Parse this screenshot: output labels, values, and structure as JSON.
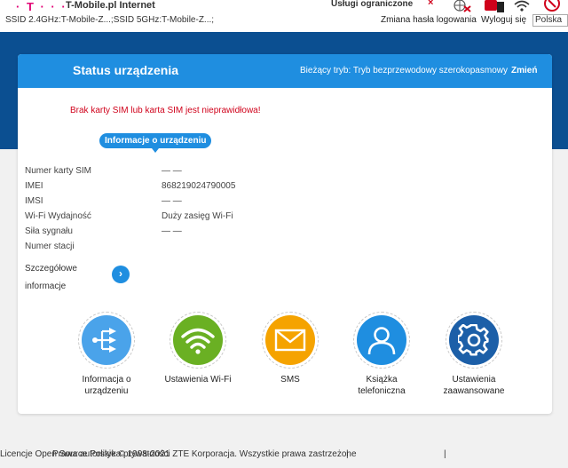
{
  "header": {
    "logo_text": "· T · · ·",
    "brand": "T-Mobile.pl Internet",
    "ssid": "SSID 2.4GHz:T-Mobile-Z...;SSID 5GHz:T-Mobile-Z...;",
    "services": "Usługi ograniczone",
    "change_password": "Zmiana hasła logowania",
    "logout": "Wyloguj się",
    "language": "Polska"
  },
  "card": {
    "title": "Status urządzenia",
    "mode": "Bieżący tryb: Tryb bezprzewodowy szerokopasmowy",
    "change": "Zmień",
    "error": "Brak karty SIM lub karta SIM jest nieprawidłowa!",
    "section": "Informacje o urządzeniu",
    "info": [
      {
        "label": "Numer karty SIM",
        "value": "— —"
      },
      {
        "label": "IMEI",
        "value": "868219024790005"
      },
      {
        "label": "IMSI",
        "value": "— —"
      },
      {
        "label": "Wi-Fi Wydajność",
        "value": "Duży zasięg Wi-Fi"
      },
      {
        "label": "Siła sygnału",
        "value": "— —"
      },
      {
        "label": "Numer stacji",
        "value": ""
      }
    ],
    "details_line1": "Szczegółowe",
    "details_line2": "informacje",
    "details_arrow": "›"
  },
  "tiles": [
    {
      "line1": "Informacja o",
      "line2": "urządzeniu",
      "color": "#4aa3ea",
      "icon": "network-icon"
    },
    {
      "line1": "Ustawienia Wi-Fi",
      "line2": "",
      "color": "#6ab023",
      "icon": "wifi-icon"
    },
    {
      "line1": "SMS",
      "line2": "",
      "color": "#f5a300",
      "icon": "envelope-icon"
    },
    {
      "line1": "Książka",
      "line2": "telefoniczna",
      "color": "#1f8ee0",
      "icon": "person-icon"
    },
    {
      "line1": "Ustawienia",
      "line2": "zaawansowane",
      "color": "#1c5fa8",
      "icon": "gear-icon"
    }
  ],
  "footer": {
    "copyright": "Prawa autorskie © 1998-2021 ZTE Korporacja. Wszystkie prawa zastrzeżone",
    "sep1": "|",
    "licence": "Licencje Open Source",
    "sep2": "|",
    "privacy": "Polityka prywatności"
  }
}
